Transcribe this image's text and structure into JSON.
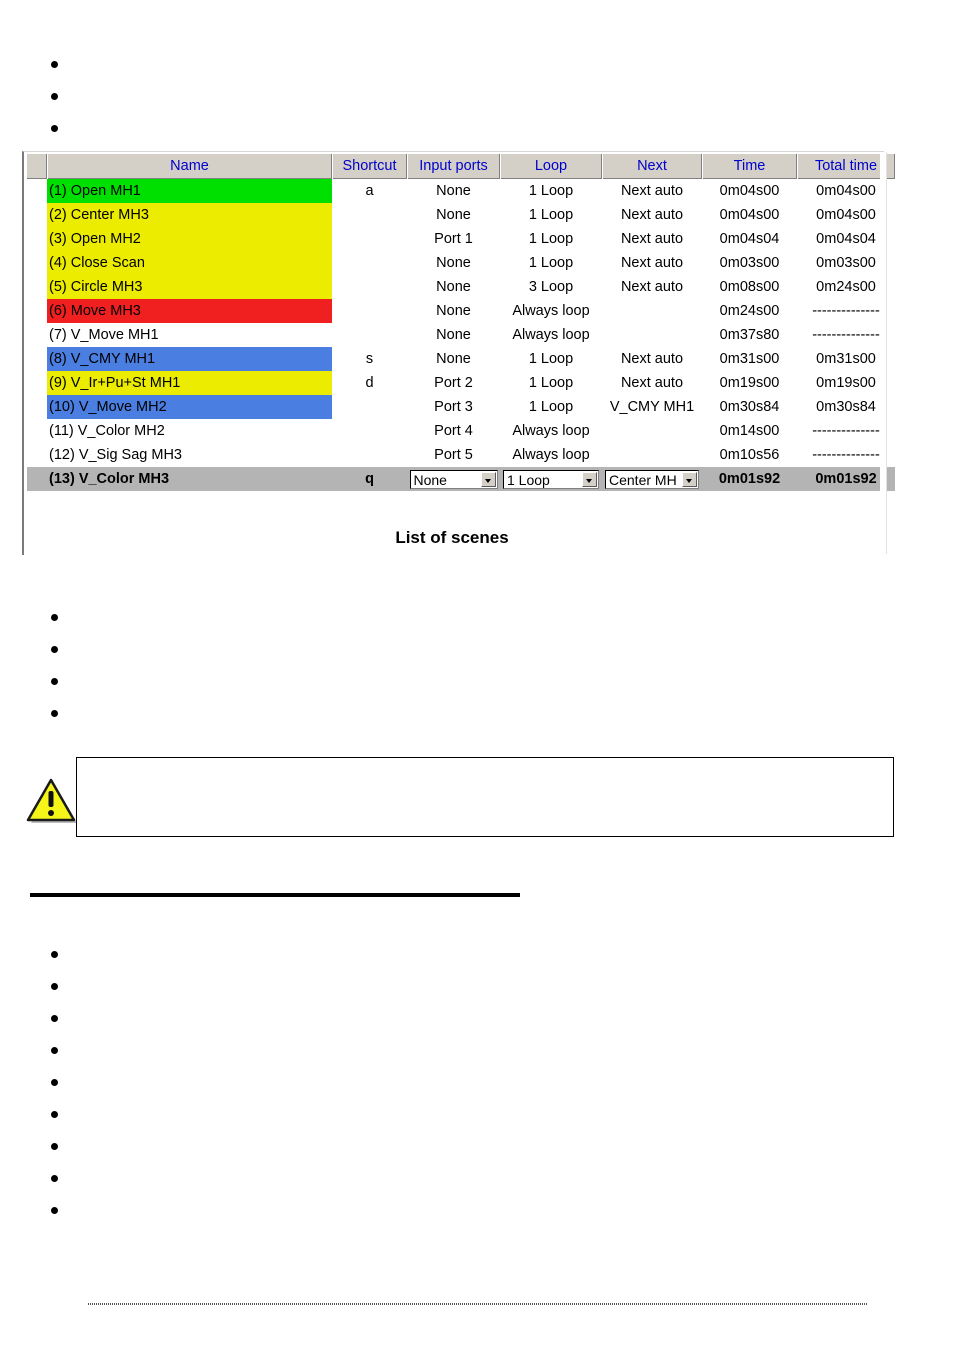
{
  "document": {
    "bullets_top": [
      "",
      "",
      ""
    ],
    "bullets_middle": [
      "",
      "",
      "",
      ""
    ],
    "bullets_bottom": [
      "",
      "",
      "",
      "",
      "",
      "",
      "",
      "",
      ""
    ],
    "note_callout_text": "",
    "warning_icon": "warning-triangle-icon",
    "section_rule": "horizontal-rule",
    "footer_rule": "dotted-footer-rule"
  },
  "figure": {
    "caption": "List of scenes",
    "colors": {
      "header_bg": "#d4d0c8",
      "header_text": "#0000cc",
      "row_green": "#00e000",
      "row_yellow": "#ecec00",
      "row_red": "#f02020",
      "row_blue": "#4a7ee0",
      "row_white": "#ffffff",
      "row_selected": "#b4b4b4"
    },
    "table": {
      "columns": [
        "Name",
        "Shortcut",
        "Input ports",
        "Loop",
        "Next",
        "Time",
        "Total time"
      ],
      "rows": [
        {
          "name": "(1) Open MH1",
          "shortcut": "a",
          "ports": "None",
          "loop": "1 Loop",
          "next": "Next auto",
          "time": "0m04s00",
          "total": "0m04s00",
          "color": "green",
          "selected": false
        },
        {
          "name": "(2) Center MH3",
          "shortcut": "",
          "ports": "None",
          "loop": "1 Loop",
          "next": "Next auto",
          "time": "0m04s00",
          "total": "0m04s00",
          "color": "yellow",
          "selected": false
        },
        {
          "name": "(3) Open MH2",
          "shortcut": "",
          "ports": "Port 1",
          "loop": "1 Loop",
          "next": "Next auto",
          "time": "0m04s04",
          "total": "0m04s04",
          "color": "yellow",
          "selected": false
        },
        {
          "name": "(4) Close Scan",
          "shortcut": "",
          "ports": "None",
          "loop": "1 Loop",
          "next": "Next auto",
          "time": "0m03s00",
          "total": "0m03s00",
          "color": "yellow",
          "selected": false
        },
        {
          "name": "(5) Circle MH3",
          "shortcut": "",
          "ports": "None",
          "loop": "3 Loop",
          "next": "Next auto",
          "time": "0m08s00",
          "total": "0m24s00",
          "color": "yellow",
          "selected": false
        },
        {
          "name": "(6) Move MH3",
          "shortcut": "",
          "ports": "None",
          "loop": "Always loop",
          "next": "",
          "time": "0m24s00",
          "total": "--------------",
          "color": "red",
          "selected": false
        },
        {
          "name": "(7) V_Move MH1",
          "shortcut": "",
          "ports": "None",
          "loop": "Always loop",
          "next": "",
          "time": "0m37s80",
          "total": "--------------",
          "color": "white",
          "selected": false
        },
        {
          "name": "(8) V_CMY MH1",
          "shortcut": "s",
          "ports": "None",
          "loop": "1 Loop",
          "next": "Next auto",
          "time": "0m31s00",
          "total": "0m31s00",
          "color": "blue",
          "selected": false
        },
        {
          "name": "(9) V_Ir+Pu+St MH1",
          "shortcut": "d",
          "ports": "Port 2",
          "loop": "1 Loop",
          "next": "Next auto",
          "time": "0m19s00",
          "total": "0m19s00",
          "color": "yellow",
          "selected": false
        },
        {
          "name": "(10) V_Move MH2",
          "shortcut": "",
          "ports": "Port 3",
          "loop": "1 Loop",
          "next": "V_CMY MH1",
          "time": "0m30s84",
          "total": "0m30s84",
          "color": "blue",
          "selected": false
        },
        {
          "name": "(11) V_Color MH2",
          "shortcut": "",
          "ports": "Port 4",
          "loop": "Always loop",
          "next": "",
          "time": "0m14s00",
          "total": "--------------",
          "color": "white",
          "selected": false
        },
        {
          "name": "(12) V_Sig Sag MH3",
          "shortcut": "",
          "ports": "Port 5",
          "loop": "Always loop",
          "next": "",
          "time": "0m10s56",
          "total": "--------------",
          "color": "white",
          "selected": false
        },
        {
          "name": "(13) V_Color MH3",
          "shortcut": "q",
          "ports": "None",
          "loop": "1 Loop",
          "next": "Center MH",
          "time": "0m01s92",
          "total": "0m01s92",
          "color": "selected",
          "selected": true
        }
      ]
    }
  }
}
